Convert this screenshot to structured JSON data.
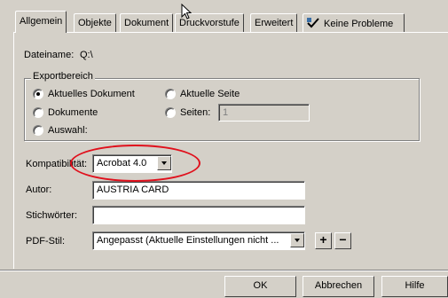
{
  "tabs": [
    {
      "label": "Allgemein",
      "underline": "A"
    },
    {
      "label": "Objekte",
      "underline": "O"
    },
    {
      "label": "Dokument",
      "underline": ""
    },
    {
      "label": "Druckvorstufe",
      "underline": "D"
    },
    {
      "label": "Erweitert",
      "underline": ""
    },
    {
      "label": "Keine Probleme",
      "icon": "warning-check-icon"
    }
  ],
  "dateiname": {
    "label": "Dateiname:",
    "value": "Q:\\"
  },
  "exportbereich": {
    "title": "Exportbereich",
    "options": {
      "aktuelles_dokument": "Aktuelles Dokument",
      "dokumente": "Dokumente",
      "auswahl": "Auswahl:",
      "aktuelle_seite": "Aktuelle Seite",
      "seiten": "Seiten:"
    },
    "selected": "aktuelles_dokument",
    "seiten_value": "1"
  },
  "kompatibilitaet": {
    "label": "Kompatibilität:",
    "value": "Acrobat 4.0"
  },
  "autor": {
    "label": "Autor:",
    "value": "AUSTRIA CARD"
  },
  "stichwoerter": {
    "label": "Stichwörter:",
    "value": ""
  },
  "pdf_stil": {
    "label": "PDF-Stil:",
    "value": "Angepasst (Aktuelle Einstellungen nicht ...",
    "add": "+",
    "remove": "−"
  },
  "buttons": {
    "ok": "OK",
    "cancel": "Abbrechen",
    "help": "Hilfe"
  },
  "colors": {
    "highlight": "#e0101c",
    "dialog_bg": "#d4d0c8"
  }
}
